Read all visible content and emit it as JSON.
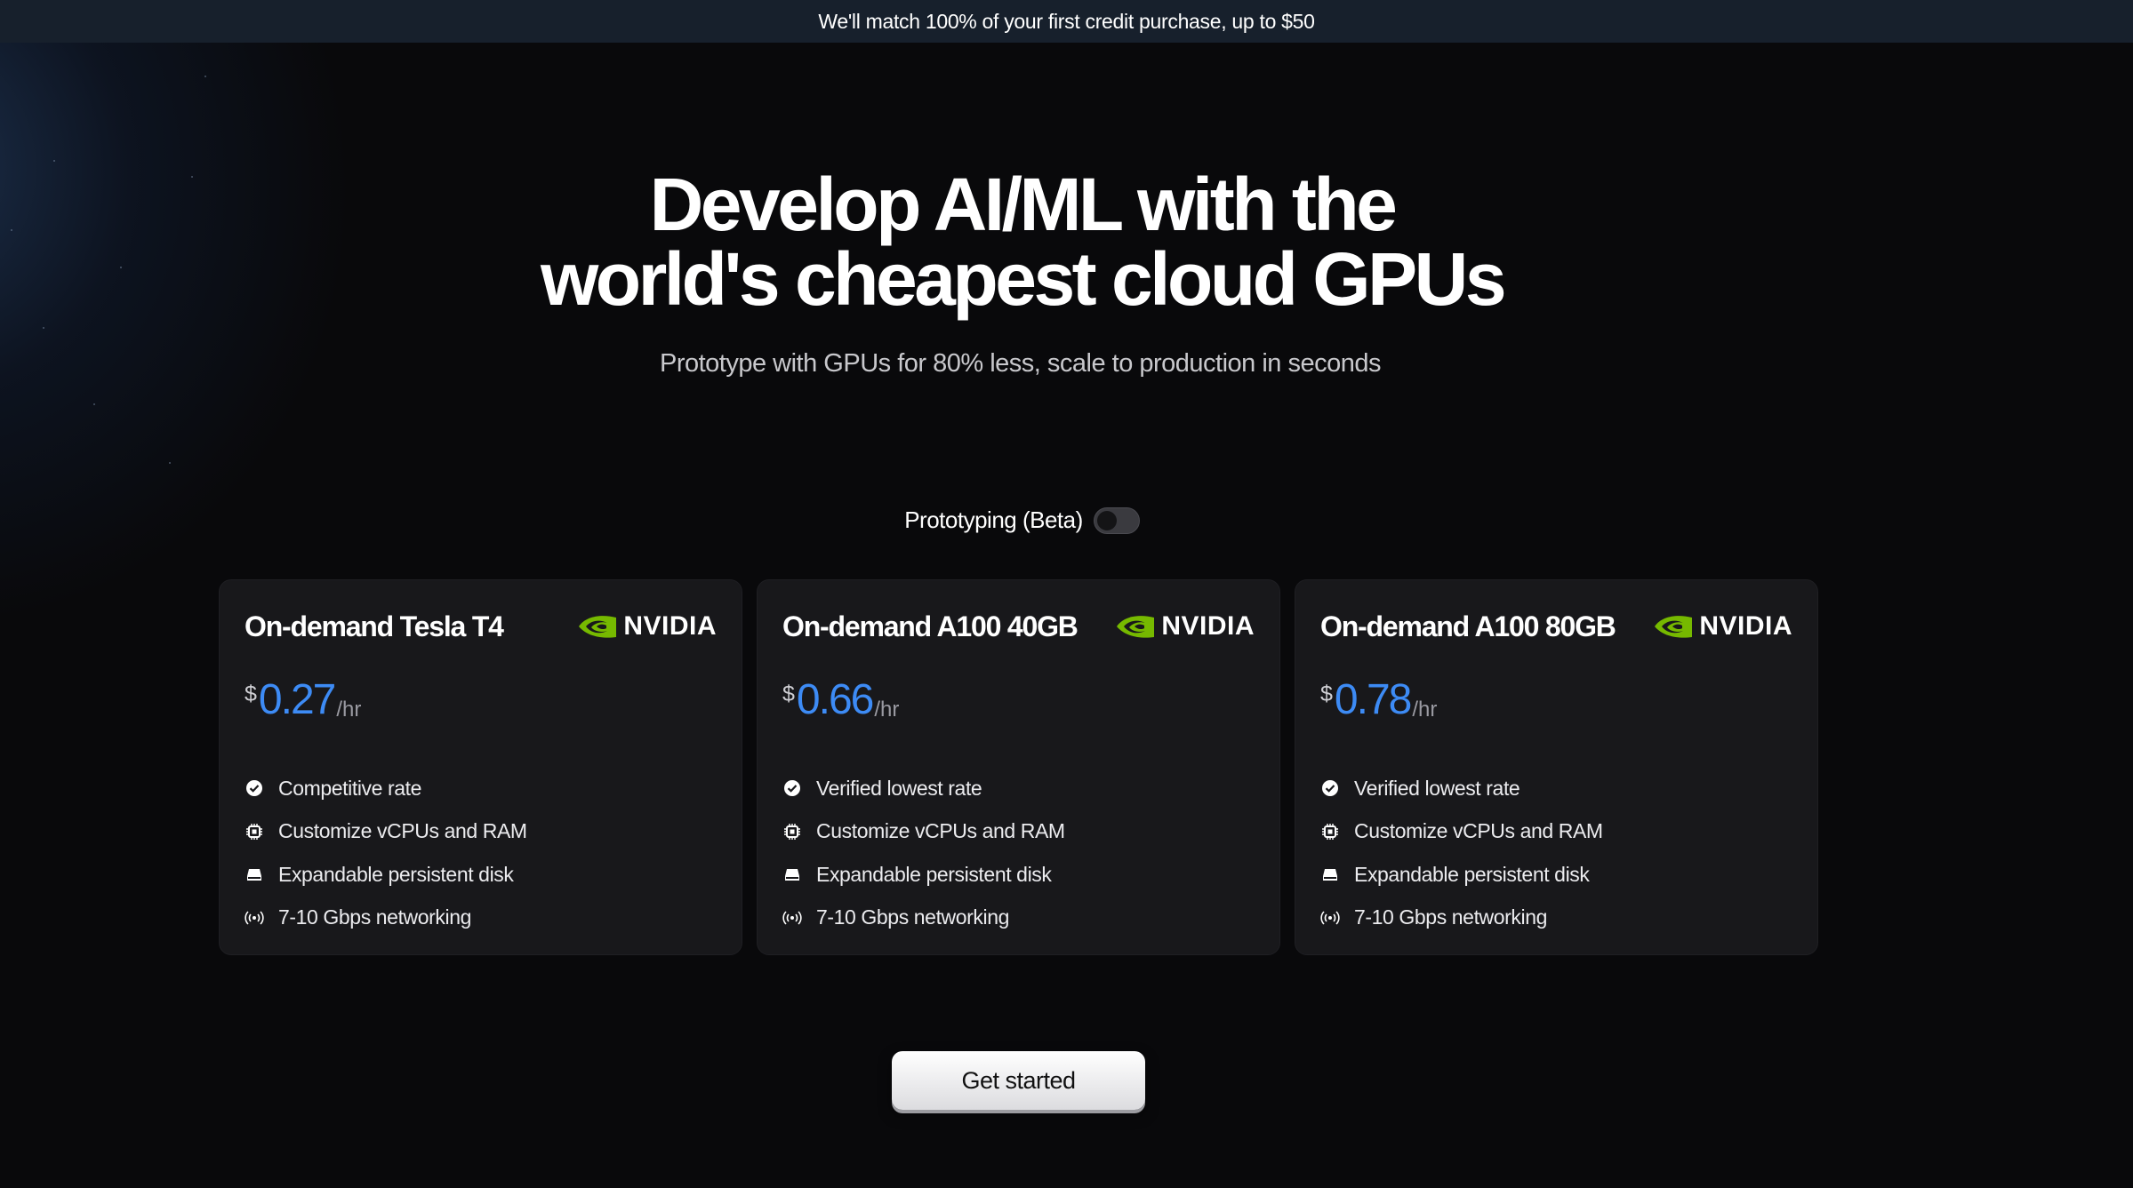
{
  "banner": {
    "text": "We'll match 100% of your first credit purchase, up to $50"
  },
  "hero": {
    "title_line1": "Develop AI/ML with the",
    "title_line2": "world's cheapest cloud GPUs",
    "subtitle": "Prototype with GPUs for 80% less, scale to production in seconds"
  },
  "toggle": {
    "label": "Prototyping (Beta)",
    "state": "off"
  },
  "brand": {
    "name": "NVIDIA",
    "logo_color": "#76b900",
    "price_color": "#3d8bf5"
  },
  "cards": [
    {
      "title": "On-demand Tesla T4",
      "brand": "NVIDIA",
      "currency": "$",
      "price": "0.27",
      "unit": "/hr",
      "features": [
        {
          "icon": "check-circle-icon",
          "text": "Competitive rate"
        },
        {
          "icon": "cpu-icon",
          "text": "Customize vCPUs and RAM"
        },
        {
          "icon": "disk-icon",
          "text": "Expandable persistent disk"
        },
        {
          "icon": "wifi-broadcast-icon",
          "text": "7-10 Gbps networking"
        }
      ]
    },
    {
      "title": "On-demand A100 40GB",
      "brand": "NVIDIA",
      "currency": "$",
      "price": "0.66",
      "unit": "/hr",
      "features": [
        {
          "icon": "check-circle-icon",
          "text": "Verified lowest rate"
        },
        {
          "icon": "cpu-icon",
          "text": "Customize vCPUs and RAM"
        },
        {
          "icon": "disk-icon",
          "text": "Expandable persistent disk"
        },
        {
          "icon": "wifi-broadcast-icon",
          "text": "7-10 Gbps networking"
        }
      ]
    },
    {
      "title": "On-demand A100 80GB",
      "brand": "NVIDIA",
      "currency": "$",
      "price": "0.78",
      "unit": "/hr",
      "features": [
        {
          "icon": "check-circle-icon",
          "text": "Verified lowest rate"
        },
        {
          "icon": "cpu-icon",
          "text": "Customize vCPUs and RAM"
        },
        {
          "icon": "disk-icon",
          "text": "Expandable persistent disk"
        },
        {
          "icon": "wifi-broadcast-icon",
          "text": "7-10 Gbps networking"
        }
      ]
    }
  ],
  "cta": {
    "label": "Get started"
  }
}
